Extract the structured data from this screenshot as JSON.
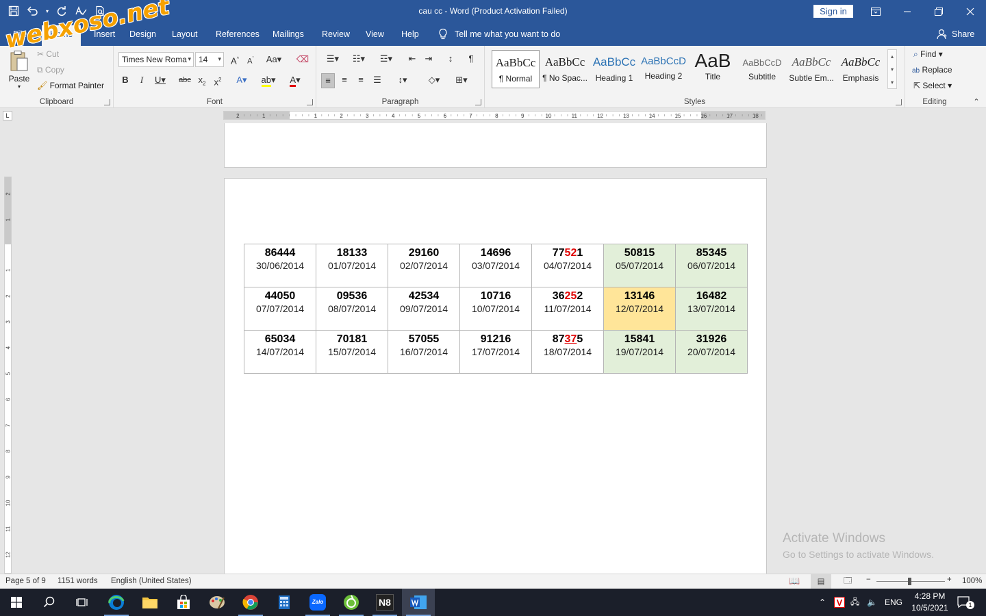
{
  "window": {
    "title": "cau cc  -  Word (Product Activation Failed)",
    "sign_in": "Sign in",
    "watermark": "webxoso.net"
  },
  "menu": {
    "tabs": [
      "File",
      "Home",
      "Insert",
      "Design",
      "Layout",
      "References",
      "Mailings",
      "Review",
      "View",
      "Help"
    ],
    "tell_me": "Tell me what you want to do",
    "share": "Share"
  },
  "ribbon": {
    "clipboard": {
      "label": "Clipboard",
      "paste": "Paste",
      "cut": "Cut",
      "copy": "Copy",
      "format_painter": "Format Painter"
    },
    "font": {
      "label": "Font",
      "font_name": "Times New Roma",
      "font_size": "14"
    },
    "paragraph": {
      "label": "Paragraph"
    },
    "styles": {
      "label": "Styles",
      "items": [
        {
          "preview": "AaBbCc",
          "name": "¶ Normal"
        },
        {
          "preview": "AaBbCc",
          "name": "¶ No Spac..."
        },
        {
          "preview": "AaBbCc",
          "name": "Heading 1"
        },
        {
          "preview": "AaBbCcD",
          "name": "Heading 2"
        },
        {
          "preview": "AaB",
          "name": "Title"
        },
        {
          "preview": "AaBbCcD",
          "name": "Subtitle"
        },
        {
          "preview": "AaBbCc",
          "name": "Subtle Em..."
        },
        {
          "preview": "AaBbCc",
          "name": "Emphasis"
        }
      ]
    },
    "editing": {
      "label": "Editing",
      "find": "Find",
      "replace": "Replace",
      "select": "Select"
    }
  },
  "ruler": {
    "h_labels": [
      "2",
      "1",
      "1",
      "2",
      "3",
      "4",
      "5",
      "6",
      "7",
      "8",
      "9",
      "10",
      "11",
      "12",
      "13",
      "14",
      "15",
      "16",
      "17",
      "18"
    ],
    "v_labels": [
      "2",
      "1",
      "1",
      "2",
      "3",
      "4",
      "5",
      "6",
      "7",
      "8",
      "9",
      "10",
      "11",
      "12"
    ]
  },
  "table": {
    "rows": [
      [
        {
          "num": "86444",
          "date": "30/06/2014"
        },
        {
          "num": "18133",
          "date": "01/07/2014"
        },
        {
          "num": "29160",
          "date": "02/07/2014"
        },
        {
          "num": "14696",
          "date": "03/07/2014"
        },
        {
          "pre": "77",
          "mid": "52",
          "post": "1",
          "date": "04/07/2014"
        },
        {
          "num": "50815",
          "date": "05/07/2014"
        },
        {
          "num": "85345",
          "date": "06/07/2014"
        }
      ],
      [
        {
          "num": "44050",
          "date": "07/07/2014"
        },
        {
          "num": "09536",
          "date": "08/07/2014"
        },
        {
          "num": "42534",
          "date": "09/07/2014"
        },
        {
          "num": "10716",
          "date": "10/07/2014"
        },
        {
          "pre": "36",
          "mid": "25",
          "post": "2",
          "date": "11/07/2014"
        },
        {
          "num": "13146",
          "date": "12/07/2014"
        },
        {
          "num": "16482",
          "date": "13/07/2014"
        }
      ],
      [
        {
          "num": "65034",
          "date": "14/07/2014"
        },
        {
          "num": "70181",
          "date": "15/07/2014"
        },
        {
          "num": "57055",
          "date": "16/07/2014"
        },
        {
          "num": "91216",
          "date": "17/07/2014"
        },
        {
          "pre": "87",
          "mid": "37",
          "post": "5",
          "date": "18/07/2014"
        },
        {
          "num": "15841",
          "date": "19/07/2014"
        },
        {
          "num": "31926",
          "date": "20/07/2014"
        }
      ]
    ],
    "colors": {
      "weekend": "#e2efd9",
      "highlight": "#ffe599",
      "accent": "#e00000"
    }
  },
  "activation": {
    "title": "Activate Windows",
    "subtitle": "Go to Settings to activate Windows."
  },
  "status": {
    "page": "Page 5 of 9",
    "words": "1151 words",
    "language": "English (United States)",
    "zoom": "100%"
  },
  "taskbar": {
    "zalo": "Zalo",
    "n8": "N8",
    "lang": "ENG",
    "time": "4:28 PM",
    "date": "10/5/2021",
    "notif_count": "1"
  },
  "colors": {
    "brand": "#2b579a"
  }
}
